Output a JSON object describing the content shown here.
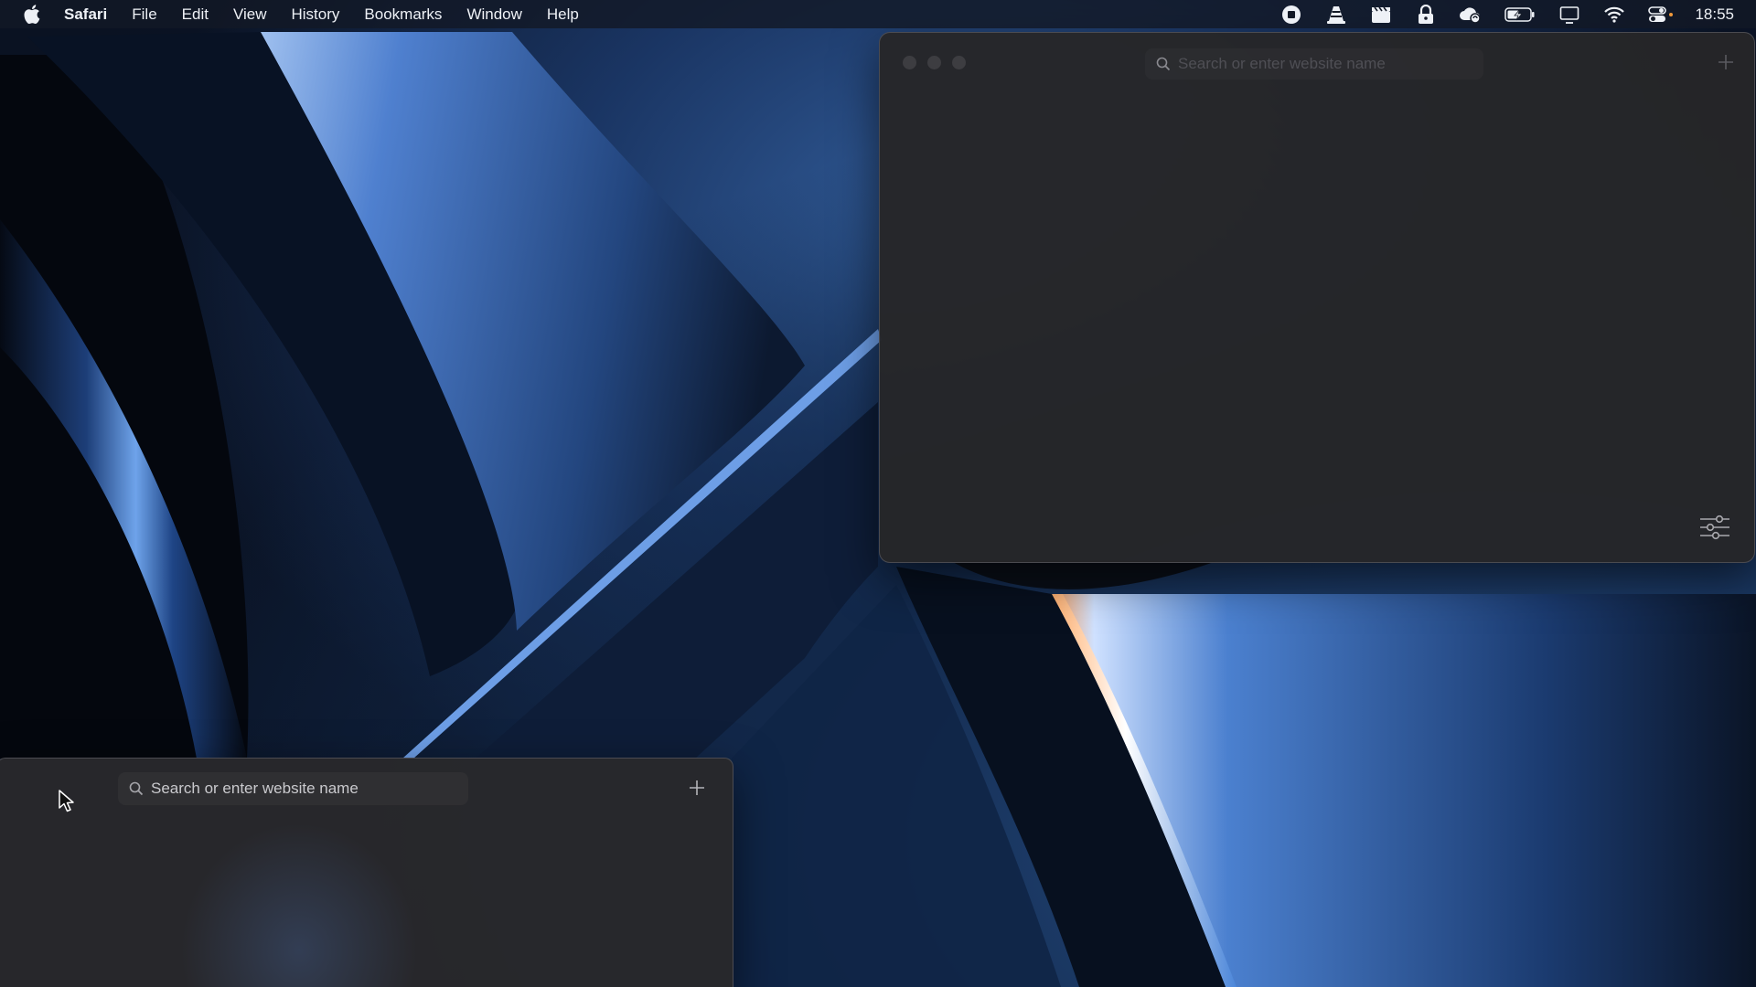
{
  "menubar": {
    "apple_icon": "apple-logo-icon",
    "app_name": "Safari",
    "items": [
      "File",
      "Edit",
      "View",
      "History",
      "Bookmarks",
      "Window",
      "Help"
    ],
    "status_icons": [
      "screen-record-stop-icon",
      "vlc-cone-icon",
      "clapperboard-icon",
      "password-lock-icon",
      "weather-cloud-icon",
      "battery-charging-icon",
      "display-mirroring-icon",
      "wifi-icon",
      "control-center-icon"
    ],
    "clock": "18:55"
  },
  "windows": {
    "top": {
      "search_placeholder": "Search or enter website name",
      "new_tab_icon": "plus-icon",
      "customize_icon": "sliders-icon"
    },
    "bottom": {
      "search_placeholder": "Search or enter website name",
      "new_tab_icon": "plus-icon"
    }
  },
  "colors": {
    "window_bg": "#262628",
    "menubar_text": "#eef1f6",
    "wallpaper_accent": "#4f86d8"
  }
}
